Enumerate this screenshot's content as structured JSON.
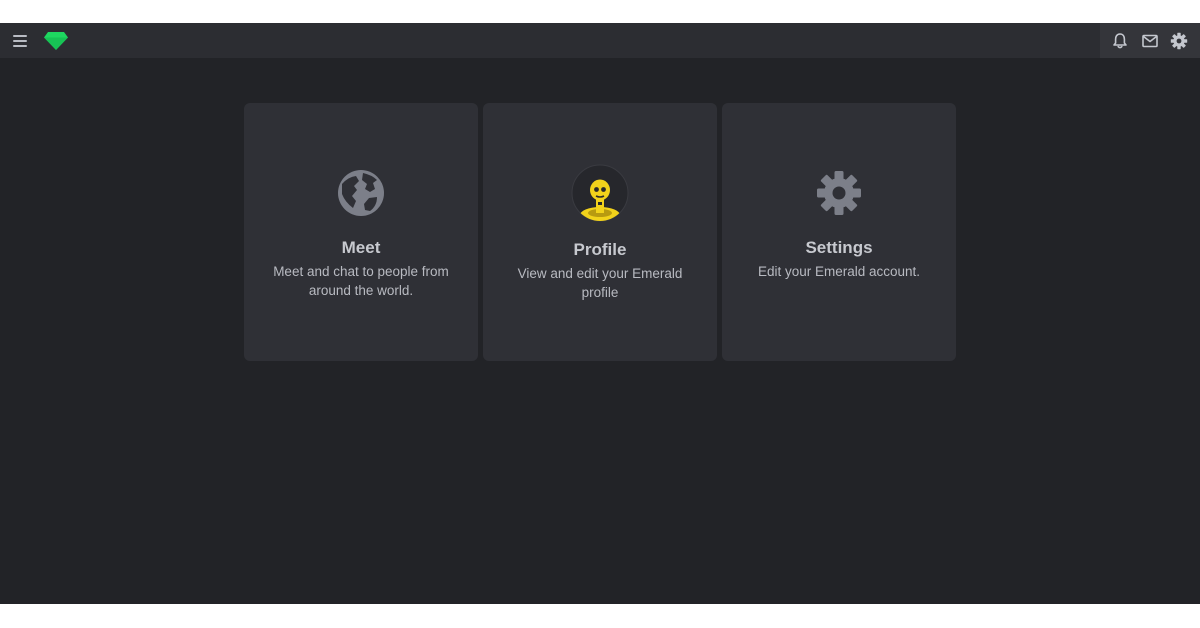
{
  "header": {
    "menu_icon": "hamburger-menu-icon",
    "logo_icon": "emerald-gem-logo",
    "logo_color": "#1ed760",
    "tools": [
      {
        "icon": "bell-icon"
      },
      {
        "icon": "mail-icon"
      },
      {
        "icon": "gear-icon"
      }
    ]
  },
  "cards": [
    {
      "icon": "globe-icon",
      "title": "Meet",
      "description": "Meet and chat to people from around the world."
    },
    {
      "icon": "avatar",
      "title": "Profile",
      "description": "View and edit your Emerald profile"
    },
    {
      "icon": "gear-icon",
      "title": "Settings",
      "description": "Edit your Emerald account."
    }
  ],
  "colors": {
    "background": "#222327",
    "topbar": "#2c2d32",
    "card": "#2f3036",
    "icon_gray": "#7c7f89",
    "avatar_yellow": "#f2d21b"
  }
}
